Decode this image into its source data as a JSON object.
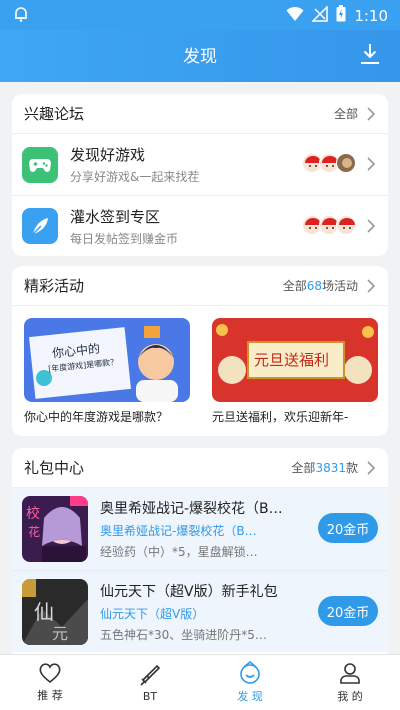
{
  "status": {
    "time": "1:10",
    "icons": [
      "notification-icon",
      "wifi-icon",
      "signal-icon",
      "battery-icon"
    ]
  },
  "header": {
    "title": "发现",
    "action_icon": "download-icon"
  },
  "forum": {
    "title": "兴趣论坛",
    "more": "全部",
    "items": [
      {
        "title": "发现好游戏",
        "subtitle": "分享好游戏&一起来找茬",
        "icon": "gamepad-icon",
        "icon_color": "#3dc177"
      },
      {
        "title": "灌水签到专区",
        "subtitle": "每日发帖签到赚金币",
        "icon": "feather-icon",
        "icon_color": "#3aa0f0"
      }
    ]
  },
  "events": {
    "title": "精彩活动",
    "more_prefix": "全部",
    "count": "68",
    "more_suffix": "场活动",
    "items": [
      {
        "caption": "你心中的年度游戏是哪款？",
        "banner_title": "你心中的",
        "banner_sub": "[年度游戏]是哪款？"
      },
      {
        "caption": "元旦送福利，欢乐迎新年-",
        "banner_title": "元旦送福利"
      }
    ]
  },
  "gifts": {
    "title": "礼包中心",
    "more_prefix": "全部",
    "count": "3831",
    "more_suffix": "款",
    "items": [
      {
        "title": "奥里希娅战记-爆裂校花（B…",
        "game": "奥里希娅战记-爆裂校花（B…",
        "desc": "经验药（中）*5，星盘解锁…",
        "button": "20金币"
      },
      {
        "title": "仙元天下（超V版）新手礼包",
        "game": "仙元天下（超V版）",
        "desc": "五色神石*30、坐骑进阶丹*5…",
        "button": "20金币"
      }
    ]
  },
  "tabbar": [
    {
      "label": "推 荐",
      "icon": "heart-icon"
    },
    {
      "label": "BT",
      "icon": "sword-icon"
    },
    {
      "label": "发 现",
      "icon": "discover-icon",
      "active": true
    },
    {
      "label": "我 的",
      "icon": "person-icon"
    }
  ],
  "colors": {
    "primary": "#2f9be8",
    "header": "#3aa0f0",
    "background": "#f1f2f4"
  }
}
